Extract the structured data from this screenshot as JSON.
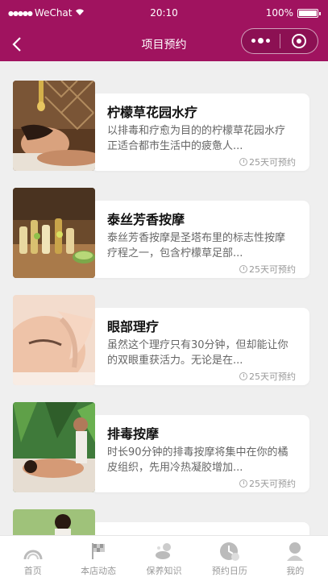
{
  "status": {
    "carrier": "WeChat",
    "time": "20:10",
    "battery": "100%"
  },
  "nav": {
    "title": "项目预约"
  },
  "items": [
    {
      "name": "柠檬草花园水疗",
      "desc": "以排毒和疗愈为目的的柠檬草花园水疗正适合都市生活中的疲惫人...",
      "avail": "25天可预约"
    },
    {
      "name": "泰丝芳香按摩",
      "desc": "泰丝芳香按摩是圣塔布里的标志性按摩疗程之一，包含柠檬草足部...",
      "avail": "25天可预约"
    },
    {
      "name": "眼部理疗",
      "desc": "虽然这个理疗只有30分钟，但却能让你的双眼重获活力。无论是在...",
      "avail": "25天可预约"
    },
    {
      "name": "排毒按摩",
      "desc": "时长90分钟的排毒按摩将集中在你的橘皮组织，先用冷热凝胶增加...",
      "avail": "25天可预约"
    }
  ],
  "tabs": [
    {
      "label": "首页",
      "icon": "home-icon"
    },
    {
      "label": "本店动态",
      "icon": "flag-icon"
    },
    {
      "label": "保养知识",
      "icon": "knowledge-icon"
    },
    {
      "label": "预约日历",
      "icon": "calendar-clock-icon"
    },
    {
      "label": "我的",
      "icon": "user-icon"
    }
  ]
}
